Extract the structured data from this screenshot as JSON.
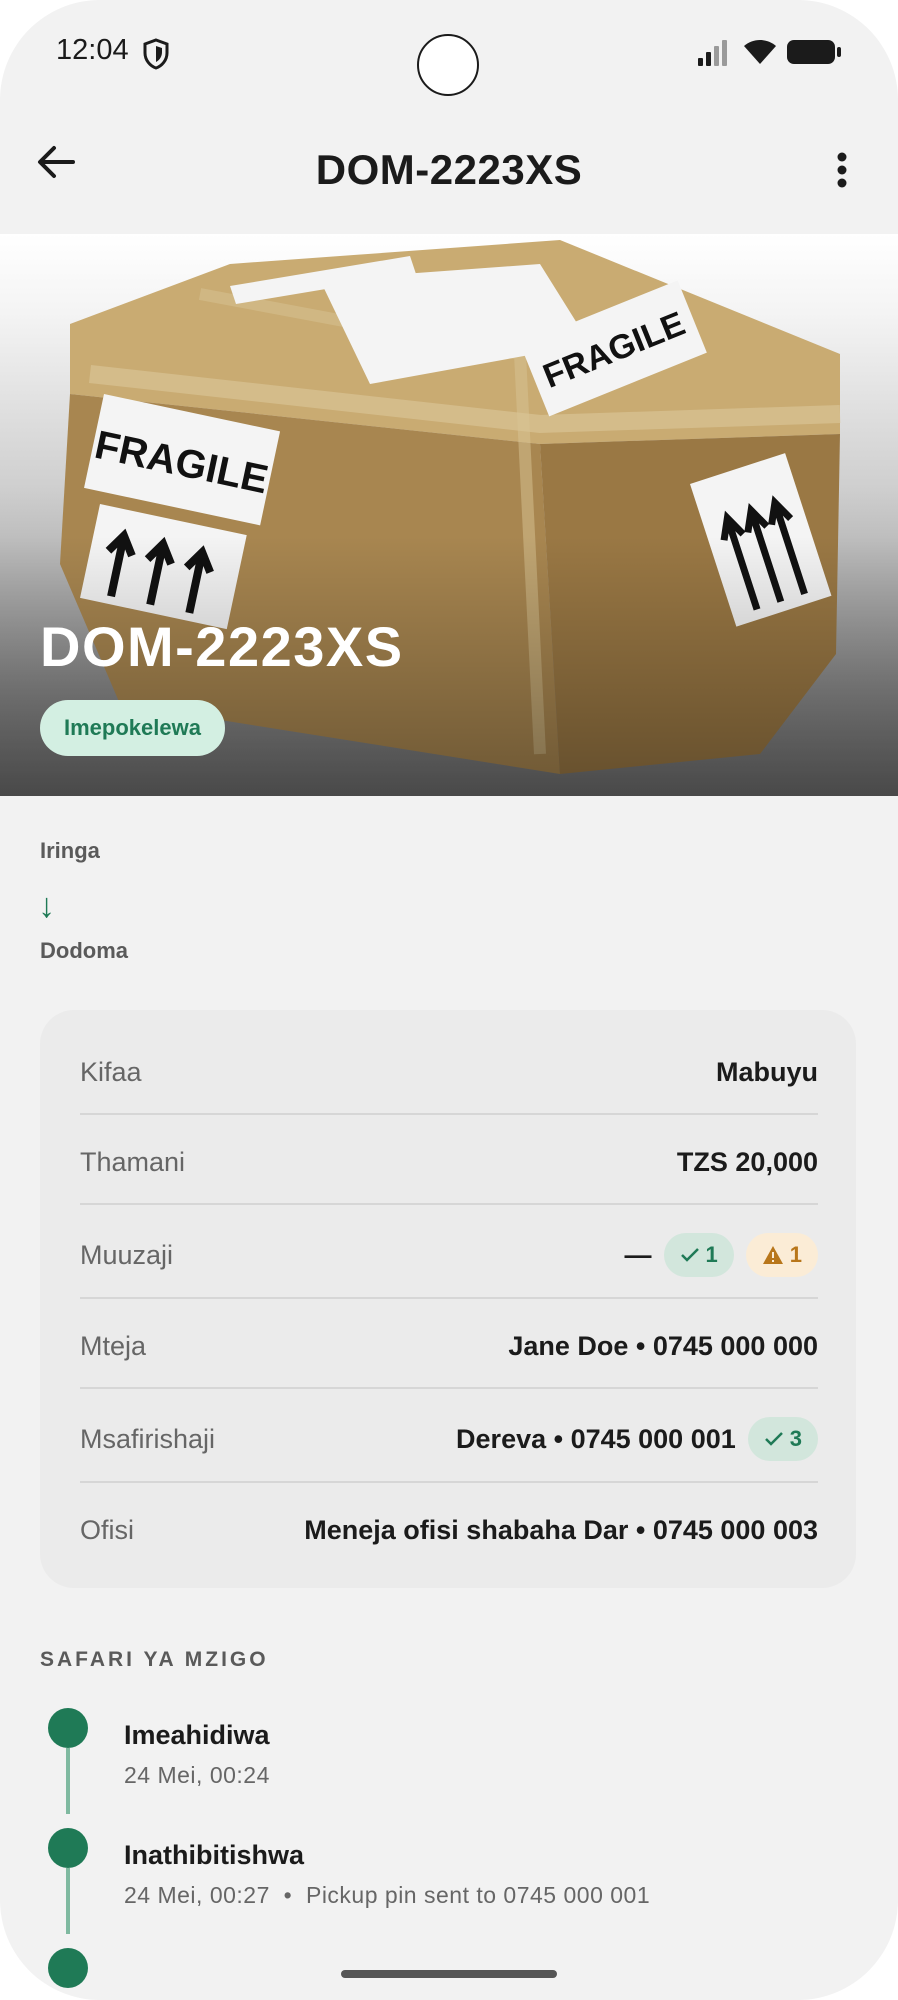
{
  "status_bar": {
    "time": "12:04"
  },
  "app_bar": {
    "title": "DOM-2223XS"
  },
  "hero": {
    "title": "DOM-2223XS",
    "status_badge": "Imepokelewa",
    "image_labels": [
      "FRAGILE",
      "FRAGILE"
    ]
  },
  "route": {
    "from": "Iringa",
    "arrow": "↓",
    "to": "Dodoma"
  },
  "details": [
    {
      "label": "Kifaa",
      "value": "Mabuyu"
    },
    {
      "label": "Thamani",
      "value": "TZS 20,000"
    },
    {
      "label": "Muuzaji",
      "value": "—",
      "ok_count": "1",
      "warn_count": "1"
    },
    {
      "label": "Mteja",
      "value": "Jane Doe • 0745 000 000"
    },
    {
      "label": "Msafirishaji",
      "value": "Dereva • 0745 000 001",
      "ok_count": "3"
    },
    {
      "label": "Ofisi",
      "value": "Meneja ofisi shabaha Dar • 0745 000 003"
    }
  ],
  "timeline": {
    "title": "SAFARI YA MZIGO",
    "events": [
      {
        "title": "Imeahidiwa",
        "subtitle": "24 Mei, 00:24"
      },
      {
        "title": "Inathibitishwa",
        "subtitle": "24 Mei, 00:27  •  Pickup pin sent to 0745 000 001"
      }
    ]
  },
  "colors": {
    "accent": "#1f7a56",
    "badge_bg": "#d3efe2",
    "warn": "#b8761a",
    "warn_bg": "#fbecd6"
  }
}
